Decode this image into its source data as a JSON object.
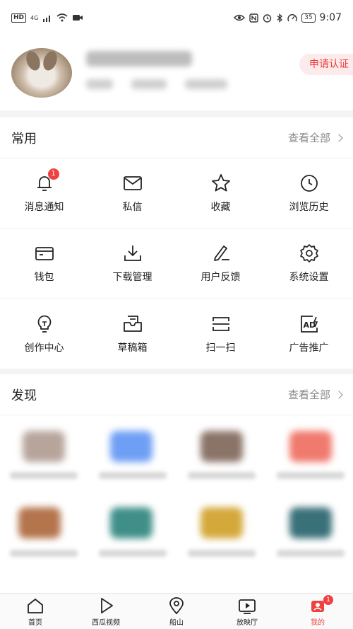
{
  "status_bar": {
    "network": "HD",
    "signal": "4G",
    "battery": "35",
    "time": "9:07"
  },
  "profile": {
    "certify_label": "申请认证"
  },
  "common": {
    "title": "常用",
    "more_label": "查看全部",
    "items": [
      {
        "label": "消息通知",
        "icon": "bell-icon",
        "badge": "1"
      },
      {
        "label": "私信",
        "icon": "mail-icon"
      },
      {
        "label": "收藏",
        "icon": "star-icon"
      },
      {
        "label": "浏览历史",
        "icon": "clock-icon"
      },
      {
        "label": "钱包",
        "icon": "wallet-icon"
      },
      {
        "label": "下载管理",
        "icon": "download-icon"
      },
      {
        "label": "用户反馈",
        "icon": "pencil-icon"
      },
      {
        "label": "系统设置",
        "icon": "gear-icon"
      },
      {
        "label": "创作中心",
        "icon": "lightbulb-icon"
      },
      {
        "label": "草稿箱",
        "icon": "draft-box-icon"
      },
      {
        "label": "扫一扫",
        "icon": "scan-icon"
      },
      {
        "label": "广告推广",
        "icon": "ad-icon"
      }
    ]
  },
  "discover": {
    "title": "发现",
    "more_label": "查看全部"
  },
  "tabbar": {
    "items": [
      {
        "label": "首页",
        "icon": "home-icon"
      },
      {
        "label": "西瓜视频",
        "icon": "play-icon"
      },
      {
        "label": "船山",
        "icon": "location-icon"
      },
      {
        "label": "放映厅",
        "icon": "tv-icon"
      },
      {
        "label": "我的",
        "icon": "profile-icon",
        "badge": "1",
        "active": true
      }
    ]
  },
  "colors": {
    "accent": "#f04142",
    "certify_bg": "#fdeaea"
  }
}
